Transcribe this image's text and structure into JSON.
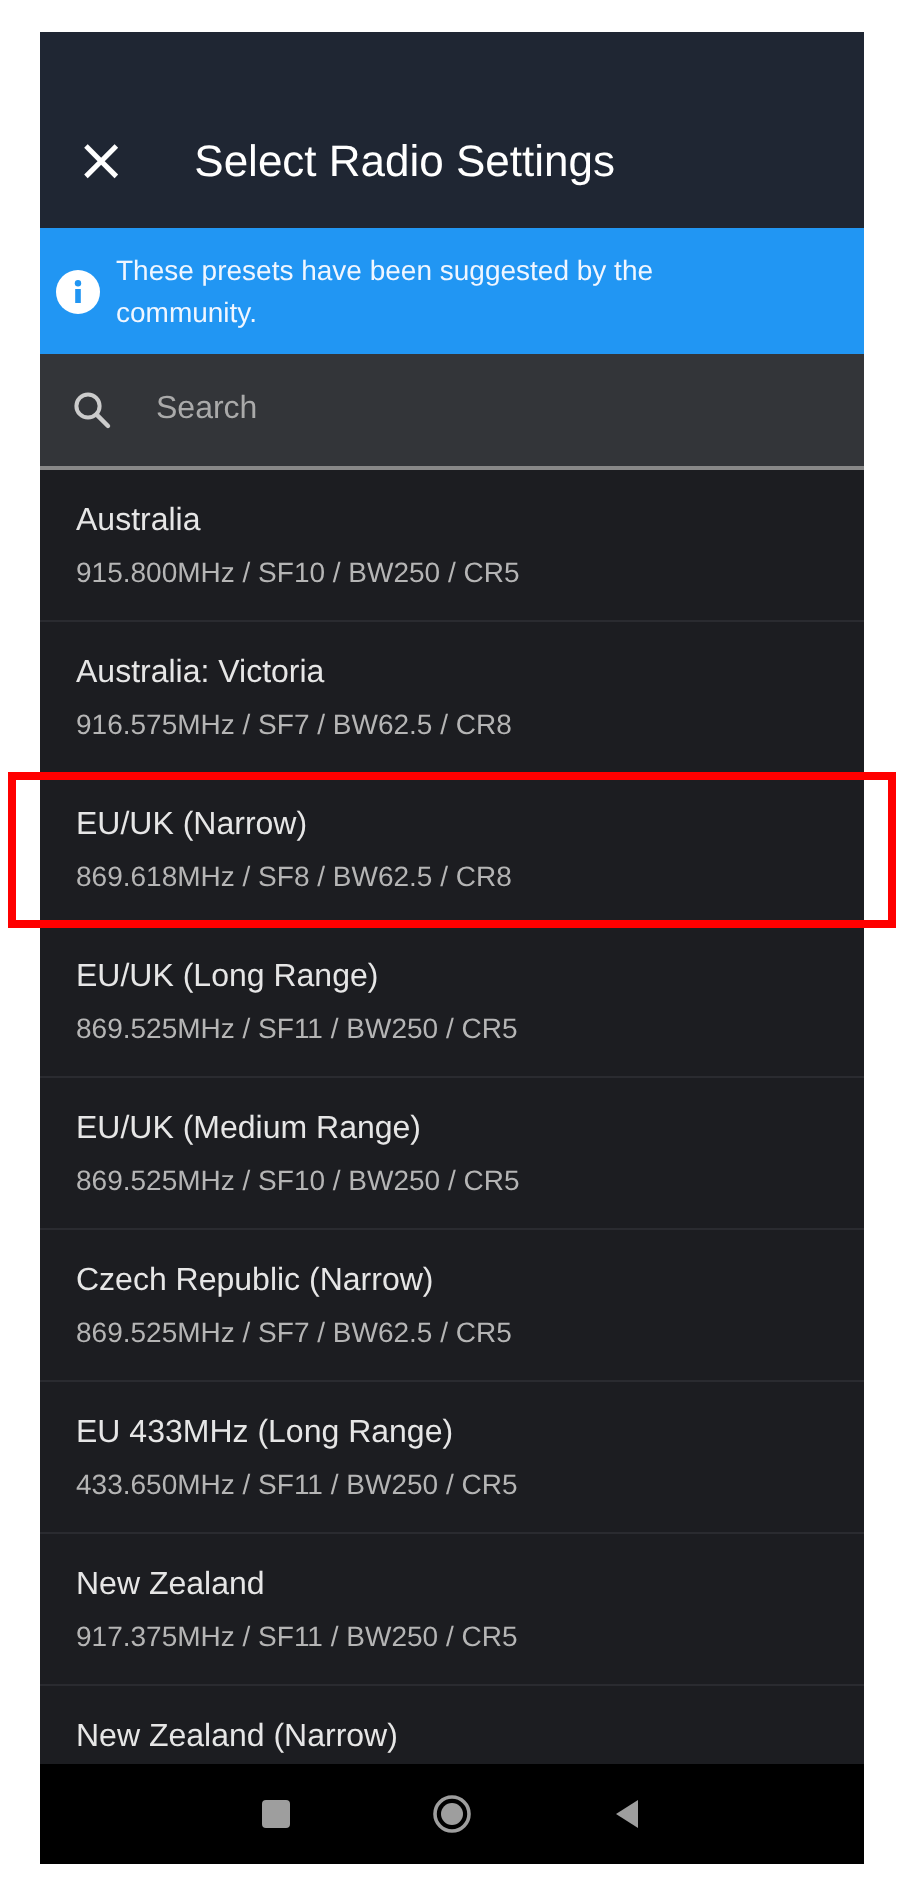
{
  "header": {
    "close_icon": "×",
    "title": "Select Radio Settings"
  },
  "banner": {
    "text": "These presets have been suggested by the community."
  },
  "search": {
    "placeholder": "Search"
  },
  "presets": [
    {
      "name": "Australia",
      "detail": "915.800MHz / SF10 / BW250 / CR5",
      "highlighted": false
    },
    {
      "name": "Australia: Victoria",
      "detail": "916.575MHz / SF7 / BW62.5 / CR8",
      "highlighted": false
    },
    {
      "name": "EU/UK (Narrow)",
      "detail": "869.618MHz / SF8 / BW62.5 / CR8",
      "highlighted": true
    },
    {
      "name": "EU/UK (Long Range)",
      "detail": "869.525MHz / SF11 / BW250 / CR5",
      "highlighted": false
    },
    {
      "name": "EU/UK (Medium Range)",
      "detail": "869.525MHz / SF10 / BW250 / CR5",
      "highlighted": false
    },
    {
      "name": "Czech Republic (Narrow)",
      "detail": "869.525MHz / SF7 / BW62.5 / CR5",
      "highlighted": false
    },
    {
      "name": "EU 433MHz (Long Range)",
      "detail": "433.650MHz / SF11 / BW250 / CR5",
      "highlighted": false
    },
    {
      "name": "New Zealand",
      "detail": "917.375MHz / SF11 / BW250 / CR5",
      "highlighted": false
    },
    {
      "name": "New Zealand (Narrow)",
      "highlighted": false
    }
  ]
}
